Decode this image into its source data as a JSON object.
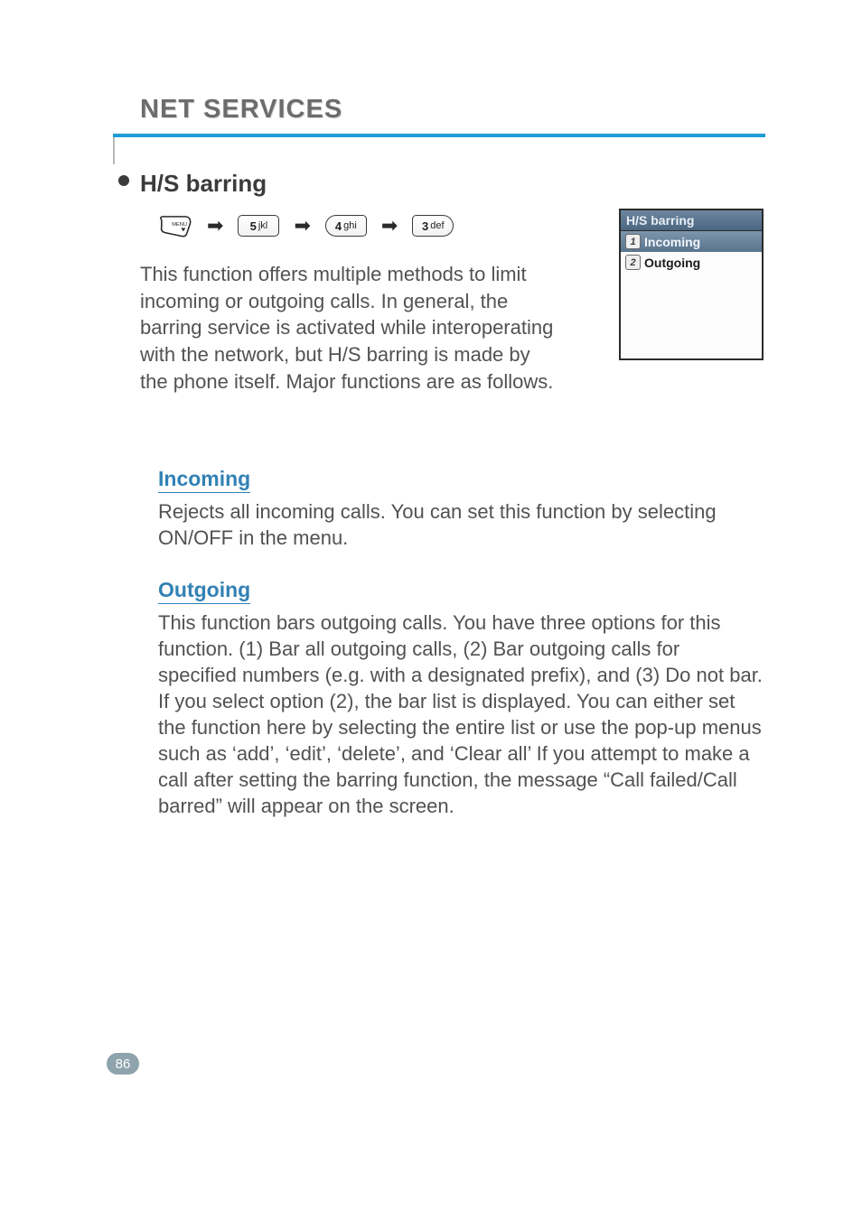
{
  "chapter": {
    "title": "NET SERVICES"
  },
  "section": {
    "title": "H/S barring",
    "keys": {
      "menu_label": "MENU",
      "k1": {
        "digit": "5",
        "letters": "jkl"
      },
      "k2": {
        "digit": "4",
        "letters": "ghi"
      },
      "k3": {
        "digit": "3",
        "letters": "def"
      }
    },
    "intro": "This function offers multiple methods to limit incoming or outgoing calls. In general, the barring service is activated while interoperating with the network, but H/S barring is made by the phone itself. Major functions are as follows."
  },
  "phone_screen": {
    "title": "H/S barring",
    "items": [
      {
        "num": "1",
        "label": "Incoming",
        "selected": true
      },
      {
        "num": "2",
        "label": "Outgoing",
        "selected": false
      }
    ]
  },
  "subsections": {
    "incoming": {
      "title": "Incoming",
      "body": "Rejects all incoming calls. You can set this function by selecting ON/OFF in the menu."
    },
    "outgoing": {
      "title": "Outgoing",
      "body": "This function bars outgoing calls. You have three options for this function. (1) Bar all outgoing calls, (2) Bar outgoing calls for specified numbers (e.g. with a designated prefix), and (3) Do not bar. If you select option (2), the bar list is displayed. You can either set the function here by selecting the entire list or use the pop-up menus such as ‘add’, ‘edit’, ‘delete’, and ‘Clear all’ If you attempt to make a call after setting the barring function, the message “Call failed/Call barred” will appear on the screen."
    }
  },
  "page_number": "86"
}
